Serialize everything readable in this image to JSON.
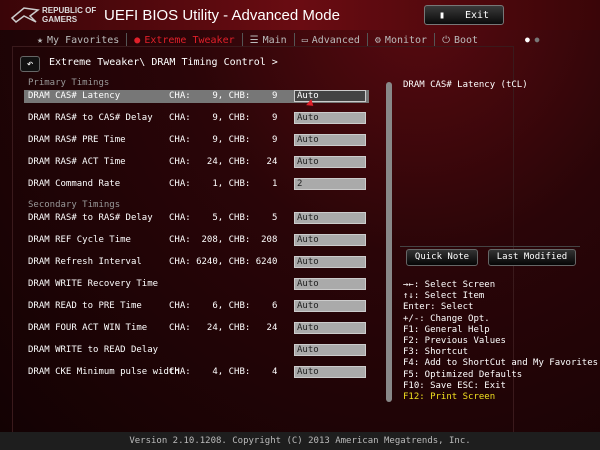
{
  "header": {
    "brand_line1": "REPUBLIC OF",
    "brand_line2": "GAMERS",
    "title": "UEFI BIOS Utility - Advanced Mode",
    "exit_label": "Exit"
  },
  "tabs": [
    {
      "label": "My Favorites",
      "icon": "star-icon"
    },
    {
      "label": "Extreme Tweaker",
      "icon": "tweaker-icon"
    },
    {
      "label": "Main",
      "icon": "list-icon"
    },
    {
      "label": "Advanced",
      "icon": "advanced-icon"
    },
    {
      "label": "Monitor",
      "icon": "monitor-icon"
    },
    {
      "label": "Boot",
      "icon": "power-icon"
    }
  ],
  "breadcrumb": "Extreme Tweaker\\ DRAM Timing Control >",
  "sections": {
    "primary": "Primary Timings",
    "secondary": "Secondary Timings"
  },
  "rows": [
    {
      "label": "DRAM CAS# Latency",
      "channels": "CHA:    9, CHB:    9",
      "value": "Auto"
    },
    {
      "label": "DRAM RAS# to CAS# Delay",
      "channels": "CHA:    9, CHB:    9",
      "value": "Auto"
    },
    {
      "label": "DRAM RAS# PRE Time",
      "channels": "CHA:    9, CHB:    9",
      "value": "Auto"
    },
    {
      "label": "DRAM RAS# ACT Time",
      "channels": "CHA:   24, CHB:   24",
      "value": "Auto"
    },
    {
      "label": "DRAM Command Rate",
      "channels": "CHA:    1, CHB:    1",
      "value": "2"
    },
    {
      "label": "DRAM RAS# to RAS# Delay",
      "channels": "CHA:    5, CHB:    5",
      "value": "Auto"
    },
    {
      "label": "DRAM REF Cycle Time",
      "channels": "CHA:  208, CHB:  208",
      "value": "Auto"
    },
    {
      "label": "DRAM Refresh Interval",
      "channels": "CHA: 6240, CHB: 6240",
      "value": "Auto"
    },
    {
      "label": "DRAM WRITE Recovery Time",
      "channels": "",
      "value": "Auto"
    },
    {
      "label": "DRAM READ to PRE Time",
      "channels": "CHA:    6, CHB:    6",
      "value": "Auto"
    },
    {
      "label": "DRAM FOUR ACT WIN Time",
      "channels": "CHA:   24, CHB:   24",
      "value": "Auto"
    },
    {
      "label": "DRAM WRITE to READ Delay",
      "channels": "",
      "value": "Auto"
    },
    {
      "label": "DRAM CKE Minimum pulse width",
      "channels": "CHA:    4, CHB:    4",
      "value": "Auto"
    }
  ],
  "help_title": "DRAM CAS# Latency (tCL)",
  "buttons": {
    "quick_note": "Quick Note",
    "last_modified": "Last Modified"
  },
  "keys": [
    "→←: Select Screen",
    "↑↓: Select Item",
    "Enter: Select",
    "+/-: Change Opt.",
    "F1: General Help",
    "F2: Previous Values",
    "F3: Shortcut",
    "F4: Add to ShortCut and My Favorites",
    "F5: Optimized Defaults",
    "F10: Save  ESC: Exit"
  ],
  "key_print": "F12: Print Screen",
  "footer": "Version 2.10.1208. Copyright (C) 2013 American Megatrends, Inc."
}
